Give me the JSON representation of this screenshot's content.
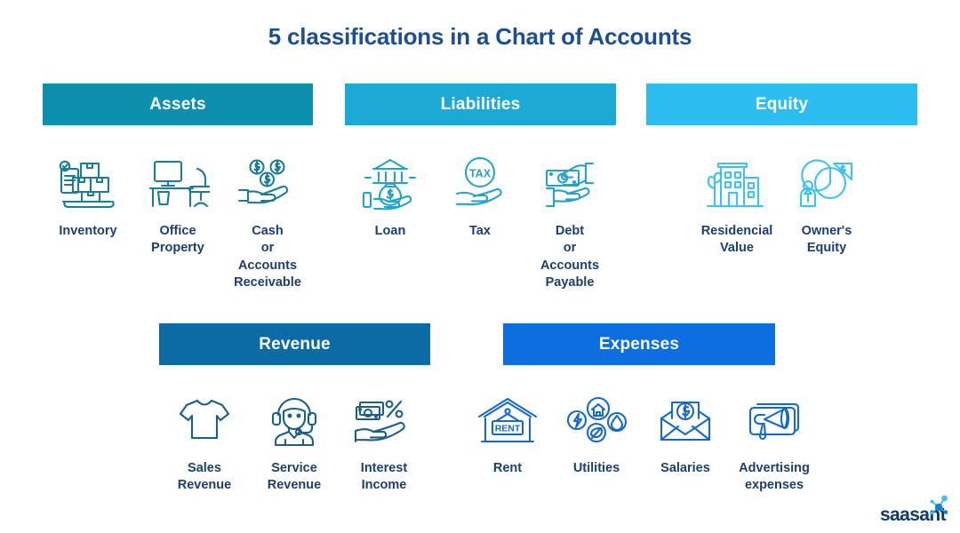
{
  "title": "5 classifications in a Chart of Accounts",
  "colors": {
    "title": "#1c4f8f",
    "label": "#1d3f6e",
    "assets_bar": "#0c90ae",
    "liabilities_bar": "#1da9d6",
    "equity_bar": "#2dbdf0",
    "revenue_bar": "#0c6ba5",
    "expenses_bar": "#0d6ee0",
    "assets_icon": "#1a7d94",
    "liabilities_icon": "#25a3c6",
    "equity_icon": "#3ec2f0",
    "revenue_icon": "#1b5e87",
    "expenses_icon": "#1769c8"
  },
  "sections": [
    {
      "id": "assets",
      "heading": "Assets",
      "items": [
        {
          "label": "Inventory",
          "icon": "inventory-boxes-icon"
        },
        {
          "label": "Office\nProperty",
          "icon": "office-desk-icon"
        },
        {
          "label": "Cash\nor\nAccounts\nReceivable",
          "icon": "hand-coins-icon"
        }
      ]
    },
    {
      "id": "liabilities",
      "heading": "Liabilities",
      "items": [
        {
          "label": "Loan",
          "icon": "bank-money-bag-icon"
        },
        {
          "label": "Tax",
          "icon": "hand-tax-icon"
        },
        {
          "label": "Debt\nor\nAccounts\nPayable",
          "icon": "hands-banknote-icon"
        }
      ]
    },
    {
      "id": "equity",
      "heading": "Equity",
      "items": [
        {
          "label": "Residencial\nValue",
          "icon": "buildings-tree-icon"
        },
        {
          "label": "Owner's\nEquity",
          "icon": "person-pie-chart-icon"
        }
      ]
    },
    {
      "id": "revenue",
      "heading": "Revenue",
      "items": [
        {
          "label": "Sales\nRevenue",
          "icon": "tshirt-icon"
        },
        {
          "label": "Service\nRevenue",
          "icon": "headset-agent-icon"
        },
        {
          "label": "Interest\nIncome",
          "icon": "hand-percent-money-icon"
        }
      ]
    },
    {
      "id": "expenses",
      "heading": "Expenses",
      "items": [
        {
          "label": "Rent",
          "icon": "house-rent-sign-icon"
        },
        {
          "label": "Utilities",
          "icon": "utilities-circles-icon"
        },
        {
          "label": "Salaries",
          "icon": "envelope-dollar-icon"
        },
        {
          "label": "Advertising\nexpenses",
          "icon": "megaphone-icon"
        }
      ]
    }
  ],
  "logo": {
    "text": "saasant",
    "mark": "node-graph-icon"
  }
}
